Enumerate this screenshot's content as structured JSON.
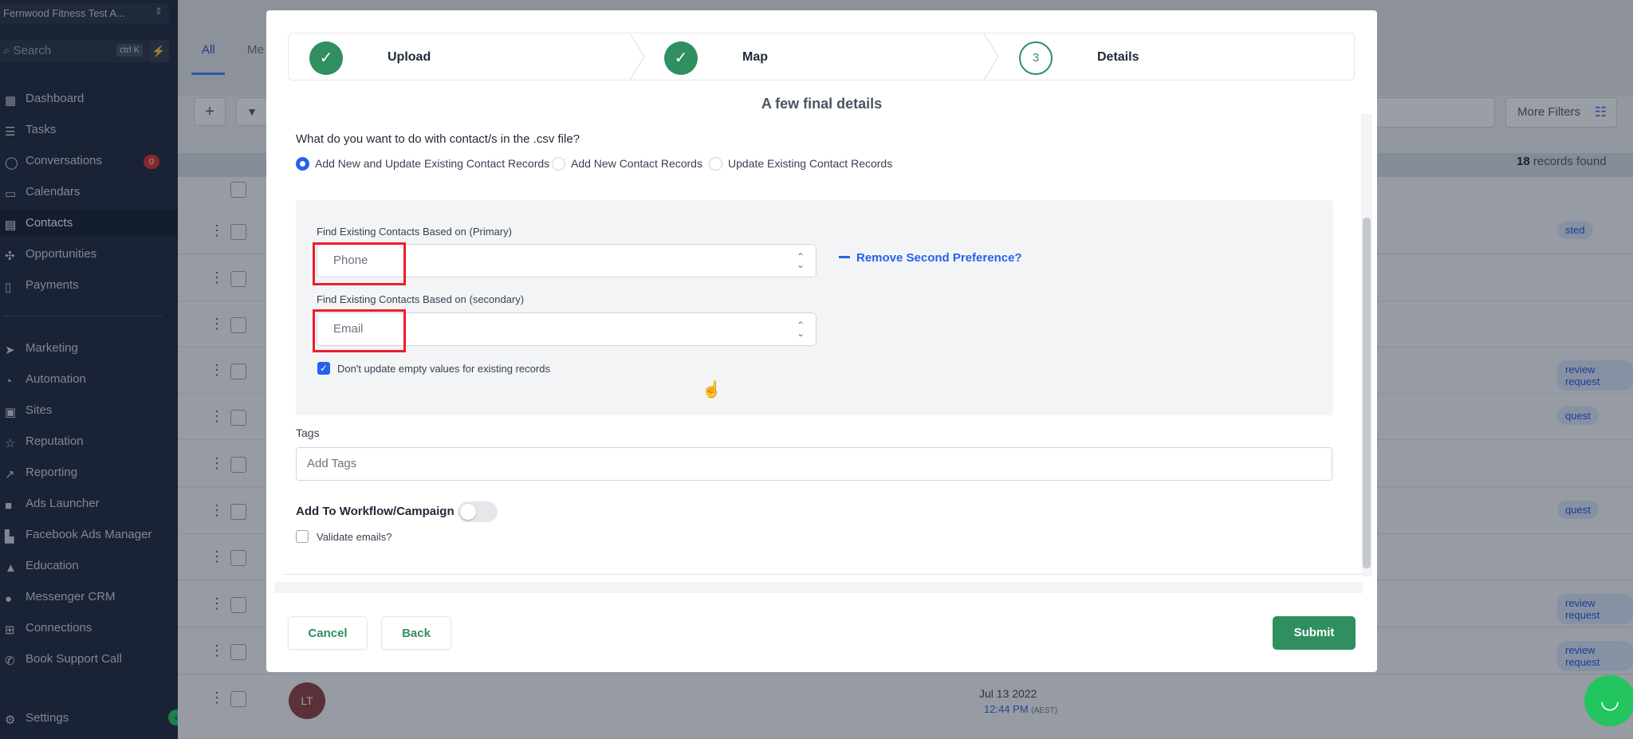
{
  "sidebar": {
    "account": "Fernwood Fitness Test A...",
    "search_placeholder": "Search",
    "search_shortcut": "ctrl K",
    "items": [
      {
        "label": "Dashboard"
      },
      {
        "label": "Tasks"
      },
      {
        "label": "Conversations",
        "badge": "0"
      },
      {
        "label": "Calendars"
      },
      {
        "label": "Contacts"
      },
      {
        "label": "Opportunities"
      },
      {
        "label": "Payments"
      },
      {
        "label": "Marketing"
      },
      {
        "label": "Automation"
      },
      {
        "label": "Sites"
      },
      {
        "label": "Reputation"
      },
      {
        "label": "Reporting"
      },
      {
        "label": "Ads Launcher"
      },
      {
        "label": "Facebook Ads Manager"
      },
      {
        "label": "Education"
      },
      {
        "label": "Messenger CRM"
      },
      {
        "label": "Connections"
      },
      {
        "label": "Book Support Call"
      },
      {
        "label": "Settings"
      }
    ]
  },
  "background": {
    "tab_all": "All",
    "tab_me": "Me",
    "more_filters": "More Filters",
    "records_count": "18",
    "records_suffix": " records found",
    "tags": [
      "sted",
      "review request",
      "quest",
      "quest",
      "review request",
      "review request"
    ],
    "avatar_initials": "LT",
    "date": "Jul 13 2022",
    "time": "12:44 PM",
    "timezone": "(AEST)"
  },
  "modal": {
    "steps": [
      {
        "label": "Upload",
        "state": "done"
      },
      {
        "label": "Map",
        "state": "done"
      },
      {
        "label": "Details",
        "state": "current",
        "number": "3"
      }
    ],
    "title": "A few final details",
    "question": "What do you want to do with contact/s in the .csv file?",
    "options": [
      {
        "label": "Add New and Update Existing Contact Records",
        "selected": true
      },
      {
        "label": "Add New Contact Records",
        "selected": false
      },
      {
        "label": "Update Existing Contact Records",
        "selected": false
      }
    ],
    "primary_label": "Find Existing Contacts Based on (Primary)",
    "primary_value": "Phone",
    "secondary_label": "Find Existing Contacts Based on (secondary)",
    "secondary_value": "Email",
    "remove_pref": "Remove Second Preference?",
    "dont_update_label": "Don't update empty values for existing records",
    "dont_update_checked": true,
    "tags_label": "Tags",
    "tags_placeholder": "Add Tags",
    "workflow_label": "Add To Workflow/Campaign",
    "workflow_on": false,
    "validate_label": "Validate emails?",
    "validate_checked": false,
    "cancel": "Cancel",
    "back": "Back",
    "submit": "Submit"
  },
  "colors": {
    "sidebar_bg": "#142033",
    "accent_green": "#2f8f5f",
    "link_blue": "#2563eb",
    "highlight_red": "#ef1c2b"
  }
}
